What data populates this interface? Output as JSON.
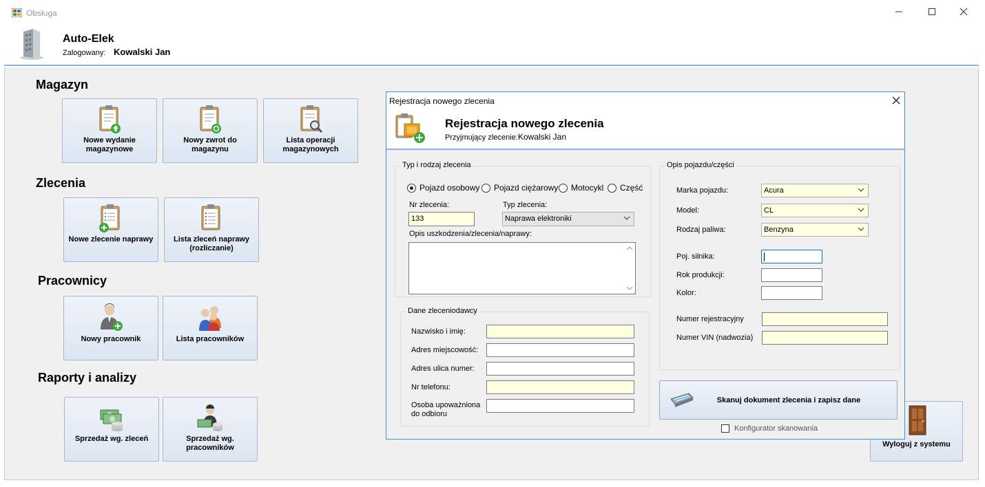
{
  "window": {
    "title": "Obsługa"
  },
  "header": {
    "app_name": "Auto-Elek",
    "logged_label": "Zalogowany:",
    "logged_user": "Kowalski Jan"
  },
  "sections": {
    "magazyn": {
      "title": "Magazyn",
      "tiles": [
        "Nowe wydanie magazynowe",
        "Nowy zwrot do magazynu",
        "Lista operacji magazynowych"
      ]
    },
    "zlecenia": {
      "title": "Zlecenia",
      "tiles": [
        "Nowe zlecenie naprawy",
        "Lista zleceń naprawy (rozliczanie)"
      ]
    },
    "pracownicy": {
      "title": "Pracownicy",
      "tiles": [
        "Nowy pracownik",
        "Lista pracowników"
      ]
    },
    "raporty": {
      "title": "Raporty i analizy",
      "tiles": [
        "Sprzedaż wg. zleceń",
        "Sprzedaż wg. pracowników"
      ]
    }
  },
  "logout": {
    "label": "Wyloguj z systemu"
  },
  "dialog": {
    "title": "Rejestracja nowego zlecenia",
    "heading": "Rejestracja nowego zlecenia",
    "receiver_label": "Przyjmujący zlecenie:",
    "receiver_value": "Kowalski Jan",
    "order_type": {
      "legend": "Typ i rodzaj zlecenia",
      "radios": [
        "Pojazd osobowy",
        "Pojazd ciężarowy",
        "Motocykl",
        "Część"
      ],
      "selected": "Pojazd osobowy",
      "order_no_label": "Nr zlecenia:",
      "order_no_value": "133",
      "type_label": "Typ zlecenia:",
      "type_value": "Naprawa elektroniki",
      "desc_label": "Opis uszkodzenia/zlecenia/naprawy:",
      "desc_value": ""
    },
    "client": {
      "legend": "Dane zleceniodawcy",
      "fields": [
        {
          "label": "Nazwisko i imię:",
          "value": ""
        },
        {
          "label": "Adres miejscowość:",
          "value": ""
        },
        {
          "label": "Adres ulica numer:",
          "value": ""
        },
        {
          "label": "Nr telefonu:",
          "value": ""
        },
        {
          "label": "Osoba upoważniona do odbioru",
          "value": ""
        }
      ]
    },
    "vehicle": {
      "legend": "Opis pojazdu/części",
      "brand_label": "Marka pojazdu:",
      "brand_value": "Acura",
      "model_label": "Model:",
      "model_value": "CL",
      "fuel_label": "Rodzaj paliwa:",
      "fuel_value": "Benzyna",
      "engine_label": "Poj. silnika:",
      "engine_value": "",
      "year_label": "Rok produkcji:",
      "year_value": "",
      "color_label": "Kolor:",
      "color_value": "",
      "reg_label": "Numer rejestracyjny",
      "reg_value": "",
      "vin_label": "Numer VIN (nadwozia)",
      "vin_value": ""
    },
    "scan_button": "Skanuj dokument zlecenia i zapisz dane",
    "scan_config": "Konfigurator skanowania"
  }
}
